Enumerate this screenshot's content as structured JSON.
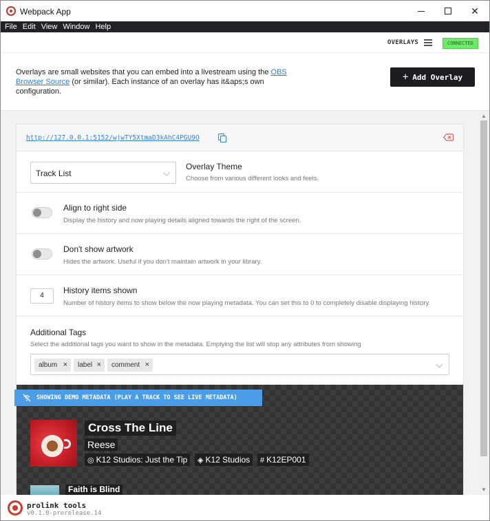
{
  "window": {
    "title": "Webpack App"
  },
  "menu": [
    "File",
    "Edit",
    "View",
    "Window",
    "Help"
  ],
  "header": {
    "overlays_label": "OVERLAYS",
    "status": "CONNECTED"
  },
  "intro": {
    "text_before": "Overlays are small websites that you can embed into a livestream using the ",
    "link": "OBS Browser Source",
    "text_after": " (or similar). Each instance of an overlay has it&aps;s own configuration.",
    "add_button": "Add Overlay",
    "add_icon": "+"
  },
  "overlay": {
    "url": "http://127.0.0.1:5152/wjwTY5XtmaD3kAhC4PGU9O",
    "theme": {
      "value": "Track List",
      "title": "Overlay Theme",
      "desc": "Choose from various different looks and feels."
    },
    "align_right": {
      "title": "Align to right side",
      "desc": "Display the history and now playing details aligned towards the right of the screen.",
      "enabled": false
    },
    "no_artwork": {
      "title": "Don't show artwork",
      "desc": "Hides the artwork. Useful if you don't maintain artwork in your library.",
      "enabled": false
    },
    "history": {
      "value": "4",
      "title": "History items shown",
      "desc": "Number of history items to show below the now playing metadata. You can set this to 0 to completely disable displaying history."
    },
    "tags": {
      "title": "Additional Tags",
      "desc": "Select the additional tags you want to show in the metadata. Emptying the list will stop any attributes from showing",
      "items": [
        {
          "label": "album",
          "remove": "×"
        },
        {
          "label": "label",
          "remove": "×"
        },
        {
          "label": "comment",
          "remove": "×"
        }
      ]
    }
  },
  "preview": {
    "banner": "SHOWING DEMO METADATA (PLAY A TRACK TO SEE LIVE METADATA)",
    "track": {
      "title": "Cross The Line",
      "artist": "Reese",
      "album": "K12 Studios: Just the Tip",
      "label": "K12 Studios",
      "comment": "K12EP001"
    },
    "history_first": "Faith is Blind"
  },
  "footer": {
    "name": "prolink tools",
    "version": "v0.1.0-prerelease.14"
  },
  "colors": {
    "accent": "#4c9de8",
    "connected": "#6ee96a",
    "brand": "#d23a2d"
  }
}
